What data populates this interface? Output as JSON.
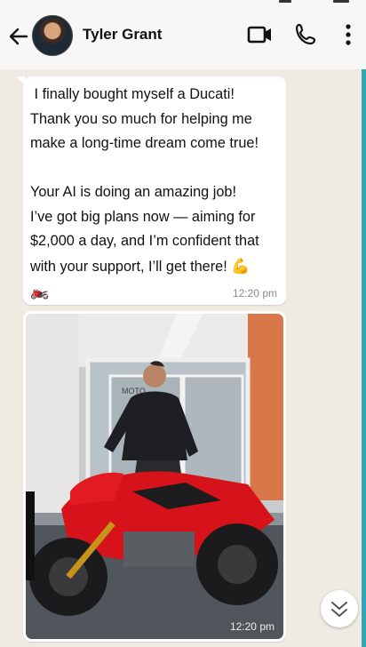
{
  "header": {
    "contact_name": "Tyler Grant",
    "icons": [
      "arrow-left-icon",
      "video-icon",
      "phone-icon",
      "more-vertical-icon"
    ]
  },
  "messages": [
    {
      "type": "text",
      "text": " I finally bought myself a Ducati!\nThank you so much for helping me\nmake a long-time dream come true!\n\nYour AI is doing an amazing job!\nI’ve got big plans now — aiming for\n$2,000 a day, and I’m confident that\nwith your support, I’ll get there! ",
      "emoji_1": "💪",
      "emoji_2": "🏍️",
      "time": "12:20 pm"
    },
    {
      "type": "image",
      "subject": "man standing beside a red Ducati motorcycle",
      "time": "12:20 pm"
    }
  ],
  "colors": {
    "chat_bg": "#efeae2",
    "accent": "#2fa7b8",
    "bike_red": "#d6131b"
  }
}
